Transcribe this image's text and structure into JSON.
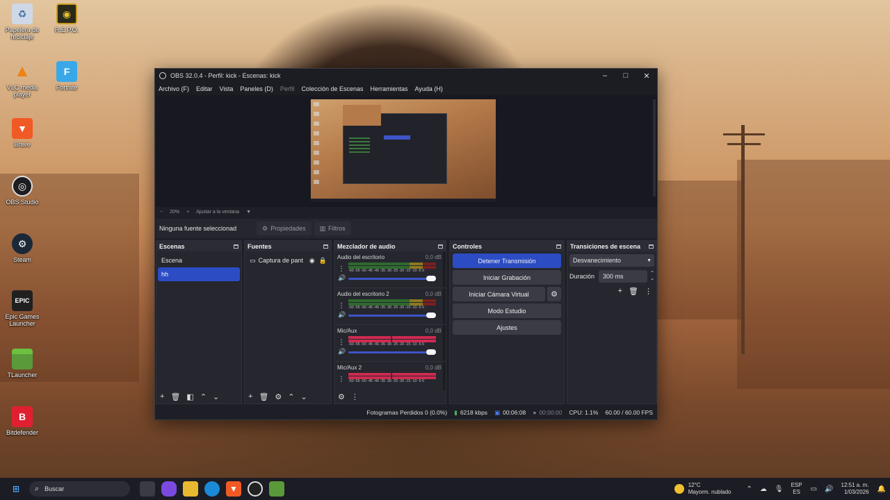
{
  "desktop": {
    "icons": [
      {
        "label": "Papelera de reciclaje"
      },
      {
        "label": "R.E.P.O."
      },
      {
        "label": "VLC media player"
      },
      {
        "label": "Fortnite"
      },
      {
        "label": "Brave"
      },
      {
        "label": "OBS Studio"
      },
      {
        "label": "Steam"
      },
      {
        "label": "Epic Games Launcher"
      },
      {
        "label": "TLauncher"
      },
      {
        "label": "Bitdefender"
      }
    ]
  },
  "window": {
    "title": "OBS 32.0.4 - Perfil: kick - Escenas: kick",
    "menu": [
      "Archivo (F)",
      "Editar",
      "Vista",
      "Paneles (D)",
      "Perfil",
      "Colección de Escenas",
      "Herramientas",
      "Ayuda (H)"
    ]
  },
  "preview": {
    "zoom": "20%",
    "fit_label": "Ajustar a la ventana"
  },
  "source_bar": {
    "no_source": "Ninguna fuente seleccionad",
    "properties": "Propiedades",
    "filters": "Filtros"
  },
  "scenes": {
    "title": "Escenas",
    "items": [
      {
        "label": "Escena",
        "selected": false
      },
      {
        "label": "hh",
        "selected": true
      }
    ]
  },
  "sources": {
    "title": "Fuentes",
    "items": [
      {
        "label": "Captura de pant"
      }
    ]
  },
  "mixer": {
    "title": "Mezclador de audio",
    "ticks": "-60 -55 -50 -45 -40 -35 -30 -25 -20 -15 -10 -5 0",
    "channels": [
      {
        "name": "Audio del escritorio",
        "db": "0,0 dB"
      },
      {
        "name": "Audio del escritorio 2",
        "db": "0,0 dB"
      },
      {
        "name": "Mic/Aux",
        "db": "0,0 dB"
      },
      {
        "name": "Mic/Aux 2",
        "db": "0,0 dB"
      }
    ]
  },
  "controls": {
    "title": "Controles",
    "stop_stream": "Detener Transmisión",
    "start_recording": "Iniciar Grabación",
    "start_virtual_cam": "Iniciar Cámara Virtual",
    "studio_mode": "Modo Estudio",
    "settings": "Ajustes"
  },
  "transitions": {
    "title": "Transiciones de escena",
    "selected": "Desvanecimiento",
    "duration_label": "Duración",
    "duration_value": "300 ms"
  },
  "status": {
    "dropped_frames": "Fotogramas Perdidos 0 (0.0%)",
    "bitrate": "6218 kbps",
    "stream_time": "00:06:08",
    "record_time": "00:00:00",
    "cpu": "CPU: 1.1%",
    "fps": "60.00 / 60.00 FPS"
  },
  "taskbar": {
    "search_placeholder": "Buscar",
    "weather_temp": "12°C",
    "weather_desc": "Mayorm. nublado",
    "lang_1": "ESP",
    "lang_2": "ES",
    "time": "12:51 a. m.",
    "date": "1/03/2026"
  }
}
